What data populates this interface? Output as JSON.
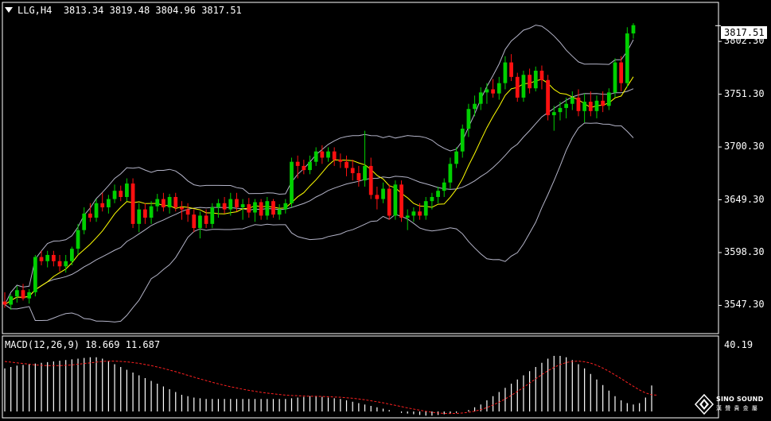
{
  "header": {
    "symbol": "LLG,H4",
    "ohlc": "3813.34 3819.48 3804.96 3817.51"
  },
  "current_price": "3817.51",
  "macd_header": "MACD(12,26,9) 18.669 11.687",
  "logo": {
    "name": "SINO SOUND",
    "sub": "漢 聲 貴 金 屬"
  },
  "colors": {
    "background": "#000000",
    "bull": "#00d000",
    "bear": "#ff1010",
    "bands": "#b4b4c8",
    "ma": "#ffff00",
    "macd_hist": "#ffffff",
    "macd_signal": "#ff2020"
  },
  "chart_data": [
    {
      "type": "candlestick",
      "ylim": [
        3520,
        3840
      ],
      "y_ticks": [
        "3802.30",
        "3751.30",
        "3700.30",
        "3649.30",
        "3598.30",
        "3547.30"
      ],
      "indicators": [
        "Bollinger Bands",
        "Moving Average"
      ],
      "candles": [
        [
          3551,
          3560,
          3545,
          3548
        ],
        [
          3548,
          3558,
          3543,
          3556
        ],
        [
          3556,
          3566,
          3550,
          3562
        ],
        [
          3562,
          3568,
          3552,
          3554
        ],
        [
          3554,
          3563,
          3549,
          3560
        ],
        [
          3560,
          3596,
          3556,
          3594
        ],
        [
          3594,
          3600,
          3586,
          3590
        ],
        [
          3590,
          3600,
          3584,
          3596
        ],
        [
          3596,
          3600,
          3585,
          3590
        ],
        [
          3590,
          3596,
          3580,
          3585
        ],
        [
          3585,
          3596,
          3579,
          3590
        ],
        [
          3590,
          3604,
          3586,
          3602
        ],
        [
          3602,
          3626,
          3596,
          3620
        ],
        [
          3620,
          3642,
          3616,
          3636
        ],
        [
          3636,
          3646,
          3628,
          3632
        ],
        [
          3632,
          3650,
          3628,
          3646
        ],
        [
          3646,
          3656,
          3638,
          3642
        ],
        [
          3642,
          3654,
          3636,
          3650
        ],
        [
          3650,
          3664,
          3646,
          3658
        ],
        [
          3658,
          3663,
          3648,
          3652
        ],
        [
          3652,
          3670,
          3648,
          3665
        ],
        [
          3665,
          3670,
          3622,
          3626
        ],
        [
          3626,
          3646,
          3618,
          3640
        ],
        [
          3640,
          3646,
          3626,
          3632
        ],
        [
          3632,
          3648,
          3626,
          3643
        ],
        [
          3643,
          3655,
          3638,
          3650
        ],
        [
          3650,
          3656,
          3638,
          3642
        ],
        [
          3642,
          3655,
          3636,
          3652
        ],
        [
          3652,
          3656,
          3638,
          3642
        ],
        [
          3642,
          3648,
          3630,
          3640
        ],
        [
          3640,
          3646,
          3628,
          3635
        ],
        [
          3635,
          3640,
          3618,
          3622
        ],
        [
          3622,
          3638,
          3612,
          3634
        ],
        [
          3634,
          3640,
          3622,
          3626
        ],
        [
          3626,
          3646,
          3622,
          3642
        ],
        [
          3642,
          3650,
          3632,
          3646
        ],
        [
          3646,
          3652,
          3636,
          3640
        ],
        [
          3640,
          3656,
          3634,
          3650
        ],
        [
          3650,
          3656,
          3638,
          3642
        ],
        [
          3642,
          3650,
          3630,
          3645
        ],
        [
          3645,
          3651,
          3632,
          3637
        ],
        [
          3637,
          3650,
          3628,
          3647
        ],
        [
          3647,
          3650,
          3630,
          3634
        ],
        [
          3634,
          3652,
          3630,
          3648
        ],
        [
          3648,
          3650,
          3632,
          3635
        ],
        [
          3635,
          3645,
          3630,
          3640
        ],
        [
          3640,
          3650,
          3636,
          3646
        ],
        [
          3646,
          3690,
          3642,
          3686
        ],
        [
          3686,
          3692,
          3670,
          3682
        ],
        [
          3682,
          3688,
          3674,
          3678
        ],
        [
          3678,
          3692,
          3674,
          3686
        ],
        [
          3686,
          3700,
          3682,
          3696
        ],
        [
          3696,
          3702,
          3684,
          3690
        ],
        [
          3690,
          3700,
          3686,
          3696
        ],
        [
          3696,
          3700,
          3682,
          3688
        ],
        [
          3688,
          3694,
          3680,
          3686
        ],
        [
          3686,
          3692,
          3672,
          3680
        ],
        [
          3680,
          3688,
          3668,
          3675
        ],
        [
          3675,
          3682,
          3662,
          3668
        ],
        [
          3668,
          3716,
          3662,
          3682
        ],
        [
          3682,
          3690,
          3650,
          3654
        ],
        [
          3654,
          3662,
          3640,
          3650
        ],
        [
          3650,
          3666,
          3646,
          3660
        ],
        [
          3660,
          3664,
          3630,
          3634
        ],
        [
          3634,
          3668,
          3630,
          3664
        ],
        [
          3664,
          3668,
          3628,
          3632
        ],
        [
          3632,
          3640,
          3620,
          3634
        ],
        [
          3634,
          3642,
          3628,
          3638
        ],
        [
          3638,
          3646,
          3630,
          3634
        ],
        [
          3634,
          3652,
          3630,
          3648
        ],
        [
          3648,
          3656,
          3640,
          3652
        ],
        [
          3652,
          3662,
          3646,
          3658
        ],
        [
          3658,
          3670,
          3652,
          3666
        ],
        [
          3666,
          3690,
          3660,
          3684
        ],
        [
          3684,
          3700,
          3680,
          3696
        ],
        [
          3696,
          3722,
          3690,
          3718
        ],
        [
          3718,
          3742,
          3710,
          3737
        ],
        [
          3737,
          3750,
          3730,
          3742
        ],
        [
          3742,
          3758,
          3736,
          3753
        ],
        [
          3753,
          3762,
          3742,
          3756
        ],
        [
          3756,
          3766,
          3748,
          3752
        ],
        [
          3752,
          3768,
          3746,
          3762
        ],
        [
          3762,
          3788,
          3756,
          3782
        ],
        [
          3782,
          3790,
          3764,
          3768
        ],
        [
          3768,
          3772,
          3744,
          3748
        ],
        [
          3748,
          3774,
          3744,
          3770
        ],
        [
          3770,
          3776,
          3752,
          3757
        ],
        [
          3757,
          3778,
          3754,
          3774
        ],
        [
          3774,
          3779,
          3756,
          3765
        ],
        [
          3765,
          3770,
          3726,
          3731
        ],
        [
          3731,
          3740,
          3716,
          3734
        ],
        [
          3734,
          3744,
          3726,
          3738
        ],
        [
          3738,
          3748,
          3728,
          3742
        ],
        [
          3742,
          3754,
          3736,
          3748
        ],
        [
          3748,
          3756,
          3730,
          3735
        ],
        [
          3735,
          3752,
          3724,
          3744
        ],
        [
          3744,
          3754,
          3730,
          3735
        ],
        [
          3735,
          3750,
          3728,
          3745
        ],
        [
          3745,
          3754,
          3734,
          3740
        ],
        [
          3740,
          3757,
          3736,
          3753
        ],
        [
          3753,
          3786,
          3748,
          3782
        ],
        [
          3782,
          3788,
          3754,
          3762
        ],
        [
          3762,
          3816,
          3758,
          3810
        ],
        [
          3810,
          3820,
          3805,
          3818
        ]
      ]
    },
    {
      "type": "bar",
      "series": [
        {
          "name": "MACD",
          "values": [
            31,
            32,
            33,
            33.5,
            34,
            34.5,
            35,
            35.5,
            36,
            36.5,
            37,
            37.5,
            38,
            38.5,
            39,
            39,
            38,
            36,
            34,
            32,
            30,
            28,
            26,
            24,
            22,
            20,
            18,
            16,
            14,
            12,
            11,
            10,
            9.5,
            9,
            9,
            9,
            9,
            9,
            9,
            9,
            9,
            9,
            9,
            9,
            9,
            9,
            9,
            9.5,
            10,
            10.5,
            11,
            11,
            10.5,
            10,
            9.5,
            9,
            8,
            7,
            6,
            5,
            4,
            3,
            2,
            1,
            0,
            -1,
            -1.5,
            -2,
            -2.5,
            -3,
            -3,
            -2.5,
            -2,
            -1.5,
            -1,
            0,
            1,
            3,
            5,
            8,
            11,
            14,
            17,
            20,
            23,
            26,
            29,
            32,
            35,
            38,
            40,
            40,
            39,
            37,
            34,
            31,
            27,
            23,
            19,
            15,
            11,
            8,
            6,
            5,
            6,
            10,
            18.7
          ]
        },
        {
          "name": "Signal",
          "values": [
            36,
            35.5,
            35,
            34.5,
            34,
            33.5,
            33.2,
            33,
            33,
            33,
            33.2,
            33.5,
            34,
            34.5,
            35,
            35.5,
            36,
            36.2,
            36.2,
            36,
            35.7,
            35.2,
            34.6,
            33.8,
            33,
            32,
            31,
            29.8,
            28.6,
            27.3,
            26,
            24.7,
            23.4,
            22.2,
            21,
            19.9,
            18.8,
            17.8,
            16.9,
            16,
            15.2,
            14.5,
            13.8,
            13.2,
            12.7,
            12.2,
            11.8,
            11.5,
            11.3,
            11.1,
            11,
            10.9,
            10.8,
            10.6,
            10.4,
            10.2,
            9.9,
            9.5,
            9,
            8.4,
            7.7,
            7,
            6.2,
            5.3,
            4.4,
            3.5,
            2.6,
            1.7,
            0.9,
            0.1,
            -0.6,
            -1.1,
            -1.4,
            -1.5,
            -1.4,
            -1.1,
            -0.6,
            0.2,
            1.3,
            2.8,
            4.6,
            6.7,
            9,
            11.6,
            14.4,
            17.3,
            20.4,
            23.5,
            26.5,
            29.3,
            31.8,
            33.8,
            35.2,
            36,
            36.2,
            35.8,
            34.8,
            33.2,
            31.2,
            28.9,
            26.3,
            23.6,
            20.8,
            18.1,
            15.5,
            13.4,
            12,
            11.7
          ]
        }
      ]
    }
  ]
}
